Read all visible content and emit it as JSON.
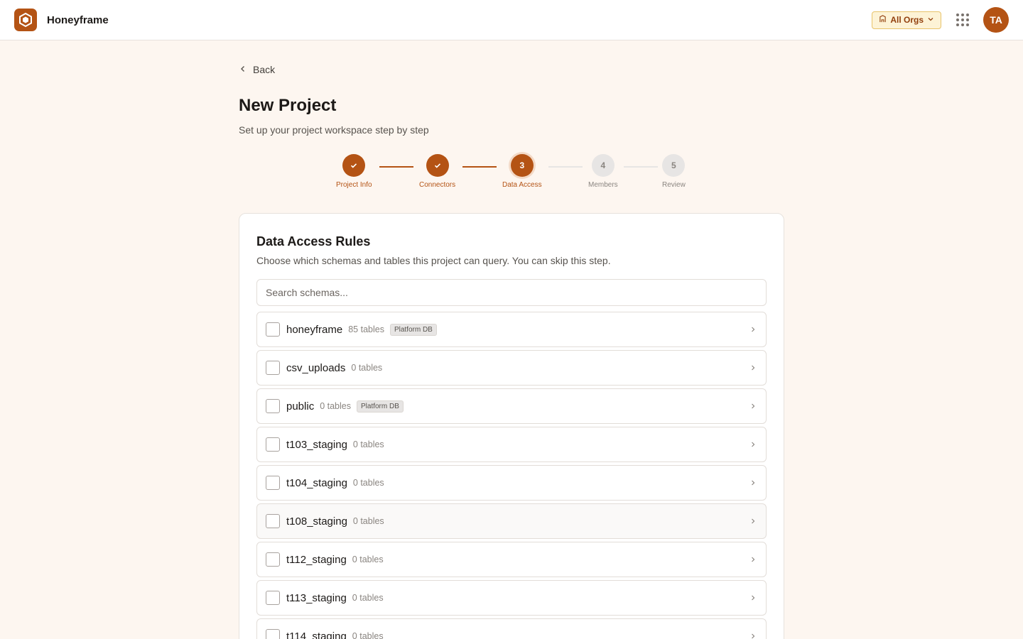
{
  "app": {
    "name": "Honeyframe"
  },
  "header": {
    "org_selector": "All Orgs",
    "avatar_initials": "TA"
  },
  "nav": {
    "back_label": "Back"
  },
  "page": {
    "title": "New Project",
    "subtitle": "Set up your project workspace step by step"
  },
  "stepper": {
    "steps": [
      {
        "number": "1",
        "label": "Project Info",
        "status": "done"
      },
      {
        "number": "2",
        "label": "Connectors",
        "status": "done"
      },
      {
        "number": "3",
        "label": "Data Access",
        "status": "current"
      },
      {
        "number": "4",
        "label": "Members",
        "status": "todo"
      },
      {
        "number": "5",
        "label": "Review",
        "status": "todo"
      }
    ]
  },
  "card": {
    "title": "Data Access Rules",
    "description": "Choose which schemas and tables this project can query. You can skip this step.",
    "search_placeholder": "Search schemas...",
    "schemas": [
      {
        "name": "honeyframe",
        "tables": "85 tables",
        "badge": "Platform DB"
      },
      {
        "name": "csv_uploads",
        "tables": "0 tables",
        "badge": ""
      },
      {
        "name": "public",
        "tables": "0 tables",
        "badge": "Platform DB"
      },
      {
        "name": "t103_staging",
        "tables": "0 tables",
        "badge": ""
      },
      {
        "name": "t104_staging",
        "tables": "0 tables",
        "badge": ""
      },
      {
        "name": "t108_staging",
        "tables": "0 tables",
        "badge": ""
      },
      {
        "name": "t112_staging",
        "tables": "0 tables",
        "badge": ""
      },
      {
        "name": "t113_staging",
        "tables": "0 tables",
        "badge": ""
      },
      {
        "name": "t114_staging",
        "tables": "0 tables",
        "badge": ""
      }
    ]
  },
  "colors": {
    "accent": "#b45314",
    "background": "#fdf6f0",
    "muted": "#e7e5e4"
  }
}
